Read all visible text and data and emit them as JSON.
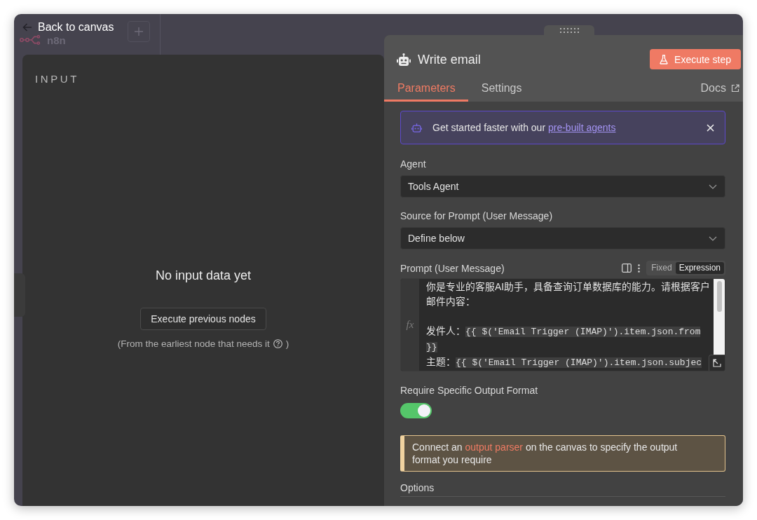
{
  "canvas": {
    "logo_text": "n8n"
  },
  "back_link": "Back to canvas",
  "input_panel": {
    "title": "INPUT",
    "empty_title": "No input data yet",
    "button": "Execute previous nodes",
    "hint": "(From the earliest node that needs it",
    "hint_end": ")"
  },
  "node_panel": {
    "title": "Write email",
    "execute_button": "Execute step",
    "tabs": [
      {
        "label": "Parameters",
        "selected": true
      },
      {
        "label": "Settings",
        "selected": false
      }
    ],
    "docs_link": "Docs",
    "banner": {
      "text": "Get started faster with our",
      "link": "pre-built agents"
    },
    "fields": [
      {
        "kind": "select",
        "label": "Agent",
        "value": "Tools Agent"
      },
      {
        "kind": "select",
        "label": "Source for Prompt (User Message)",
        "value": "Define below"
      },
      {
        "kind": "prompt",
        "label": "Prompt (User Message)",
        "modes": [
          {
            "label": "Fixed",
            "selected": false
          },
          {
            "label": "Expression",
            "selected": true
          }
        ],
        "gutter": "fx",
        "paragraphs": [
          {
            "kind": "line",
            "segments": [
              {
                "kind": "text",
                "text": "你是专业的客服AI助手，具备查询订单数据库的能力。请根据客户邮件内容："
              }
            ]
          },
          {
            "kind": "blank"
          },
          {
            "kind": "line",
            "segments": [
              {
                "kind": "text",
                "text": "发件人："
              },
              {
                "kind": "expression",
                "text": "{{ $('Email Trigger (IMAP)').item.json.from }}"
              }
            ]
          },
          {
            "kind": "line",
            "segments": [
              {
                "kind": "text",
                "text": "主题："
              },
              {
                "kind": "expression",
                "text": "{{ $('Email Trigger (IMAP)').item.json.subjec"
              }
            ]
          }
        ]
      },
      {
        "kind": "switch",
        "label": "Require Specific Output Format",
        "on": true
      }
    ],
    "notice": {
      "before": "Connect an",
      "link": "output parser",
      "after": "on the canvas to specify the output format you require"
    },
    "section": "Options"
  }
}
